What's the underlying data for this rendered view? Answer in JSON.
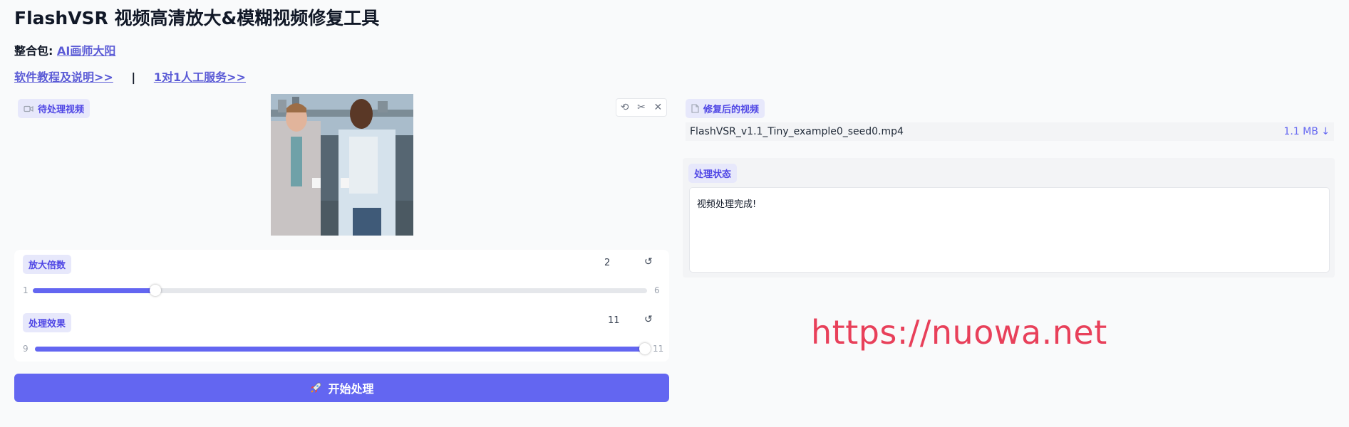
{
  "header": {
    "title": "FlashVSR 视频高清放大&模糊视频修复工具",
    "package_label": "整合包:",
    "package_link": "AI画师大阳",
    "tutorial_link": "软件教程及说明>>",
    "separator": "|",
    "service_link": "1对1人工服务>>"
  },
  "input_video": {
    "label": "待处理视频",
    "label_icon": "video-camera-icon",
    "tools": [
      "undo-icon",
      "scissors-icon",
      "close-icon"
    ]
  },
  "scale_slider": {
    "label": "放大倍数",
    "value": "2",
    "min": "1",
    "max": "6",
    "fraction": 0.2,
    "reset": "↺"
  },
  "effect_slider": {
    "label": "处理效果",
    "value": "11",
    "min": "9",
    "max": "11",
    "fraction": 1.0,
    "reset": "↺"
  },
  "start_button": {
    "icon": "rocket-icon",
    "label": "开始处理"
  },
  "output_video": {
    "label": "修复后的视频",
    "label_icon": "file-icon",
    "file_name": "FlashVSR_v1.1_Tiny_example0_seed0.mp4",
    "file_size": "1.1 MB ↓"
  },
  "status": {
    "label": "处理状态",
    "text": "视频处理完成!"
  },
  "watermark": "https://nuowa.net",
  "colors": {
    "accent": "#6366f1",
    "chip_bg": "#e7e8fb",
    "watermark": "#e8405a"
  }
}
